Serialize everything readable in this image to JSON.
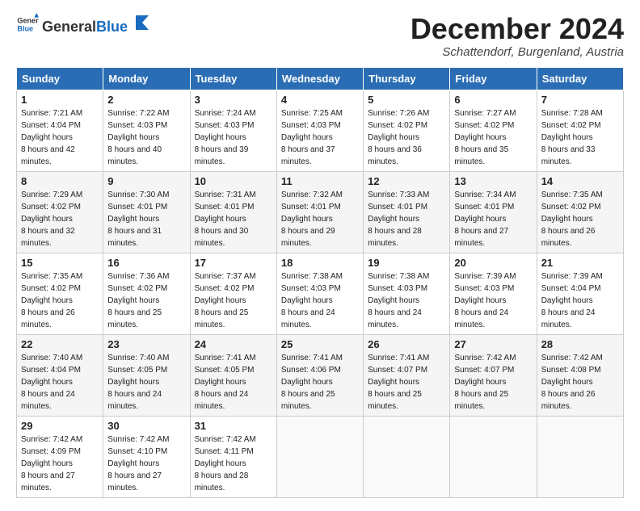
{
  "header": {
    "logo_general": "General",
    "logo_blue": "Blue",
    "month_title": "December 2024",
    "subtitle": "Schattendorf, Burgenland, Austria"
  },
  "weekdays": [
    "Sunday",
    "Monday",
    "Tuesday",
    "Wednesday",
    "Thursday",
    "Friday",
    "Saturday"
  ],
  "weeks": [
    [
      {
        "day": "1",
        "sunrise": "7:21 AM",
        "sunset": "4:04 PM",
        "daylight": "8 hours and 42 minutes."
      },
      {
        "day": "2",
        "sunrise": "7:22 AM",
        "sunset": "4:03 PM",
        "daylight": "8 hours and 40 minutes."
      },
      {
        "day": "3",
        "sunrise": "7:24 AM",
        "sunset": "4:03 PM",
        "daylight": "8 hours and 39 minutes."
      },
      {
        "day": "4",
        "sunrise": "7:25 AM",
        "sunset": "4:03 PM",
        "daylight": "8 hours and 37 minutes."
      },
      {
        "day": "5",
        "sunrise": "7:26 AM",
        "sunset": "4:02 PM",
        "daylight": "8 hours and 36 minutes."
      },
      {
        "day": "6",
        "sunrise": "7:27 AM",
        "sunset": "4:02 PM",
        "daylight": "8 hours and 35 minutes."
      },
      {
        "day": "7",
        "sunrise": "7:28 AM",
        "sunset": "4:02 PM",
        "daylight": "8 hours and 33 minutes."
      }
    ],
    [
      {
        "day": "8",
        "sunrise": "7:29 AM",
        "sunset": "4:02 PM",
        "daylight": "8 hours and 32 minutes."
      },
      {
        "day": "9",
        "sunrise": "7:30 AM",
        "sunset": "4:01 PM",
        "daylight": "8 hours and 31 minutes."
      },
      {
        "day": "10",
        "sunrise": "7:31 AM",
        "sunset": "4:01 PM",
        "daylight": "8 hours and 30 minutes."
      },
      {
        "day": "11",
        "sunrise": "7:32 AM",
        "sunset": "4:01 PM",
        "daylight": "8 hours and 29 minutes."
      },
      {
        "day": "12",
        "sunrise": "7:33 AM",
        "sunset": "4:01 PM",
        "daylight": "8 hours and 28 minutes."
      },
      {
        "day": "13",
        "sunrise": "7:34 AM",
        "sunset": "4:01 PM",
        "daylight": "8 hours and 27 minutes."
      },
      {
        "day": "14",
        "sunrise": "7:35 AM",
        "sunset": "4:02 PM",
        "daylight": "8 hours and 26 minutes."
      }
    ],
    [
      {
        "day": "15",
        "sunrise": "7:35 AM",
        "sunset": "4:02 PM",
        "daylight": "8 hours and 26 minutes."
      },
      {
        "day": "16",
        "sunrise": "7:36 AM",
        "sunset": "4:02 PM",
        "daylight": "8 hours and 25 minutes."
      },
      {
        "day": "17",
        "sunrise": "7:37 AM",
        "sunset": "4:02 PM",
        "daylight": "8 hours and 25 minutes."
      },
      {
        "day": "18",
        "sunrise": "7:38 AM",
        "sunset": "4:03 PM",
        "daylight": "8 hours and 24 minutes."
      },
      {
        "day": "19",
        "sunrise": "7:38 AM",
        "sunset": "4:03 PM",
        "daylight": "8 hours and 24 minutes."
      },
      {
        "day": "20",
        "sunrise": "7:39 AM",
        "sunset": "4:03 PM",
        "daylight": "8 hours and 24 minutes."
      },
      {
        "day": "21",
        "sunrise": "7:39 AM",
        "sunset": "4:04 PM",
        "daylight": "8 hours and 24 minutes."
      }
    ],
    [
      {
        "day": "22",
        "sunrise": "7:40 AM",
        "sunset": "4:04 PM",
        "daylight": "8 hours and 24 minutes."
      },
      {
        "day": "23",
        "sunrise": "7:40 AM",
        "sunset": "4:05 PM",
        "daylight": "8 hours and 24 minutes."
      },
      {
        "day": "24",
        "sunrise": "7:41 AM",
        "sunset": "4:05 PM",
        "daylight": "8 hours and 24 minutes."
      },
      {
        "day": "25",
        "sunrise": "7:41 AM",
        "sunset": "4:06 PM",
        "daylight": "8 hours and 25 minutes."
      },
      {
        "day": "26",
        "sunrise": "7:41 AM",
        "sunset": "4:07 PM",
        "daylight": "8 hours and 25 minutes."
      },
      {
        "day": "27",
        "sunrise": "7:42 AM",
        "sunset": "4:07 PM",
        "daylight": "8 hours and 25 minutes."
      },
      {
        "day": "28",
        "sunrise": "7:42 AM",
        "sunset": "4:08 PM",
        "daylight": "8 hours and 26 minutes."
      }
    ],
    [
      {
        "day": "29",
        "sunrise": "7:42 AM",
        "sunset": "4:09 PM",
        "daylight": "8 hours and 27 minutes."
      },
      {
        "day": "30",
        "sunrise": "7:42 AM",
        "sunset": "4:10 PM",
        "daylight": "8 hours and 27 minutes."
      },
      {
        "day": "31",
        "sunrise": "7:42 AM",
        "sunset": "4:11 PM",
        "daylight": "8 hours and 28 minutes."
      },
      null,
      null,
      null,
      null
    ]
  ]
}
